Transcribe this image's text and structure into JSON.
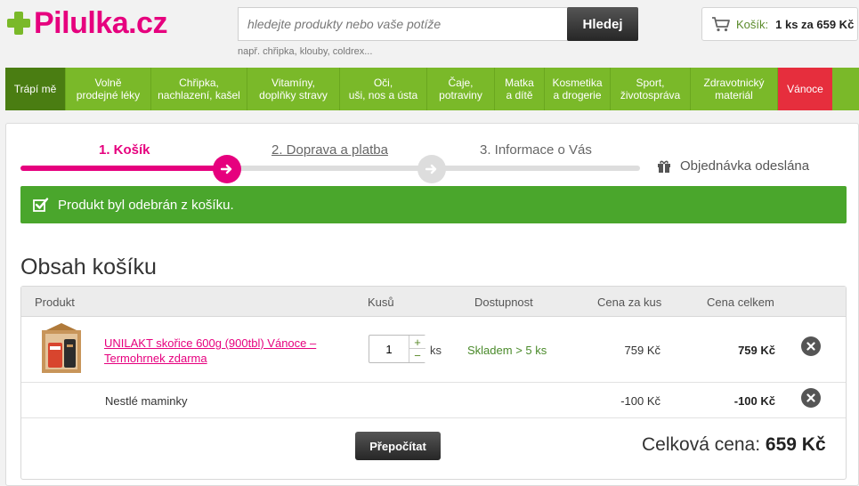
{
  "header": {
    "logo_text": "Pilulka.cz",
    "search_placeholder": "hledejte produkty nebo vaše potíže",
    "search_button": "Hledej",
    "search_hint": "např. chřipka, klouby, coldrex...",
    "cart_label": "Košík:",
    "cart_value": "1 ks za 659 Kč"
  },
  "nav": {
    "items": [
      {
        "label": "Trápí mě",
        "width": 68
      },
      {
        "label": "Volně\nprodejné léky",
        "width": 96
      },
      {
        "label": "Chřipka,\nnachlazení, kašel",
        "width": 108
      },
      {
        "label": "Vitamíny,\ndoplňky stravy",
        "width": 104
      },
      {
        "label": "Oči,\nuši, nos a ústa",
        "width": 98
      },
      {
        "label": "Čaje,\npotraviny",
        "width": 76
      },
      {
        "label": "Matka\na dítě",
        "width": 56
      },
      {
        "label": "Kosmetika\na drogerie",
        "width": 74
      },
      {
        "label": "Sport,\nživotospráva",
        "width": 90
      },
      {
        "label": "Zdravotnický\nmateriál",
        "width": 98
      },
      {
        "label": "Vánoce",
        "width": 61
      }
    ]
  },
  "steps": {
    "step1": "1. Košík",
    "step2": "2. Doprava a platba",
    "step3": "3. Informace o Vás",
    "step4": "Objednávka odeslána"
  },
  "alert": {
    "message": "Produkt byl odebrán z košíku."
  },
  "cart": {
    "title": "Obsah košíku",
    "columns": {
      "product": "Produkt",
      "qty": "Kusů",
      "availability": "Dostupnost",
      "unit_price": "Cena za kus",
      "total_price": "Cena celkem"
    },
    "items": [
      {
        "name": "UNILAKT skořice 600g (900tbl) Vánoce – Termohrnek zdarma",
        "qty": "1",
        "unit": "ks",
        "availability": "Skladem > 5 ks",
        "unit_price": "759 Kč",
        "total_price": "759 Kč"
      }
    ],
    "discount": {
      "name": "Nestlé maminky",
      "unit_price": "-100 Kč",
      "total_price": "-100 Kč"
    },
    "recalc_button": "Přepočítat",
    "total_label": "Celková cena:",
    "total_value": "659 Kč"
  },
  "colors": {
    "brand_pink": "#e6007e",
    "brand_green": "#7ab929",
    "alert_green": "#4aa62c",
    "christmas_red": "#e62e3d"
  }
}
